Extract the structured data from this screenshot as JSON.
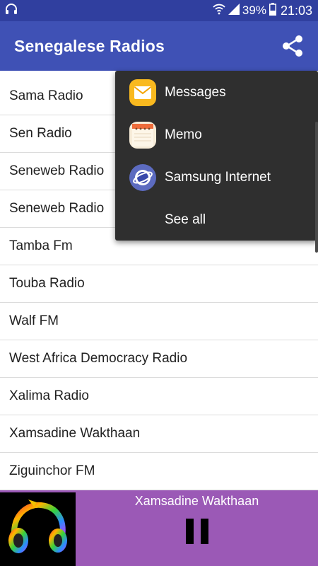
{
  "status_bar": {
    "battery": "39%",
    "time": "21:03",
    "icons": [
      "headset-icon",
      "wifi-icon",
      "signal-icon",
      "battery-icon"
    ]
  },
  "app_bar": {
    "title": "Senegalese Radios",
    "share_icon": "share-icon"
  },
  "radios": [
    "Sama Radio",
    "Sen Radio",
    "Seneweb Radio",
    "Seneweb Radio",
    "Tamba Fm",
    "Touba Radio",
    "Walf FM",
    "West Africa Democracy Radio",
    "Xalima Radio",
    "Xamsadine Wakthaan",
    "Ziguinchor FM"
  ],
  "share_menu": {
    "items": [
      {
        "label": "Messages",
        "icon": "messages-icon"
      },
      {
        "label": "Memo",
        "icon": "memo-icon"
      },
      {
        "label": "Samsung Internet",
        "icon": "samsung-internet-icon"
      },
      {
        "label": "See all",
        "icon": ""
      }
    ]
  },
  "player": {
    "now_playing": "Xamsadine Wakthaan",
    "art_icon": "headphones-art",
    "control_icon": "pause-icon"
  },
  "colors": {
    "status_bar": "#303f9f",
    "app_bar": "#3f51b5",
    "player_bg": "#9b59b6",
    "menu_bg": "#2f2f2f"
  }
}
